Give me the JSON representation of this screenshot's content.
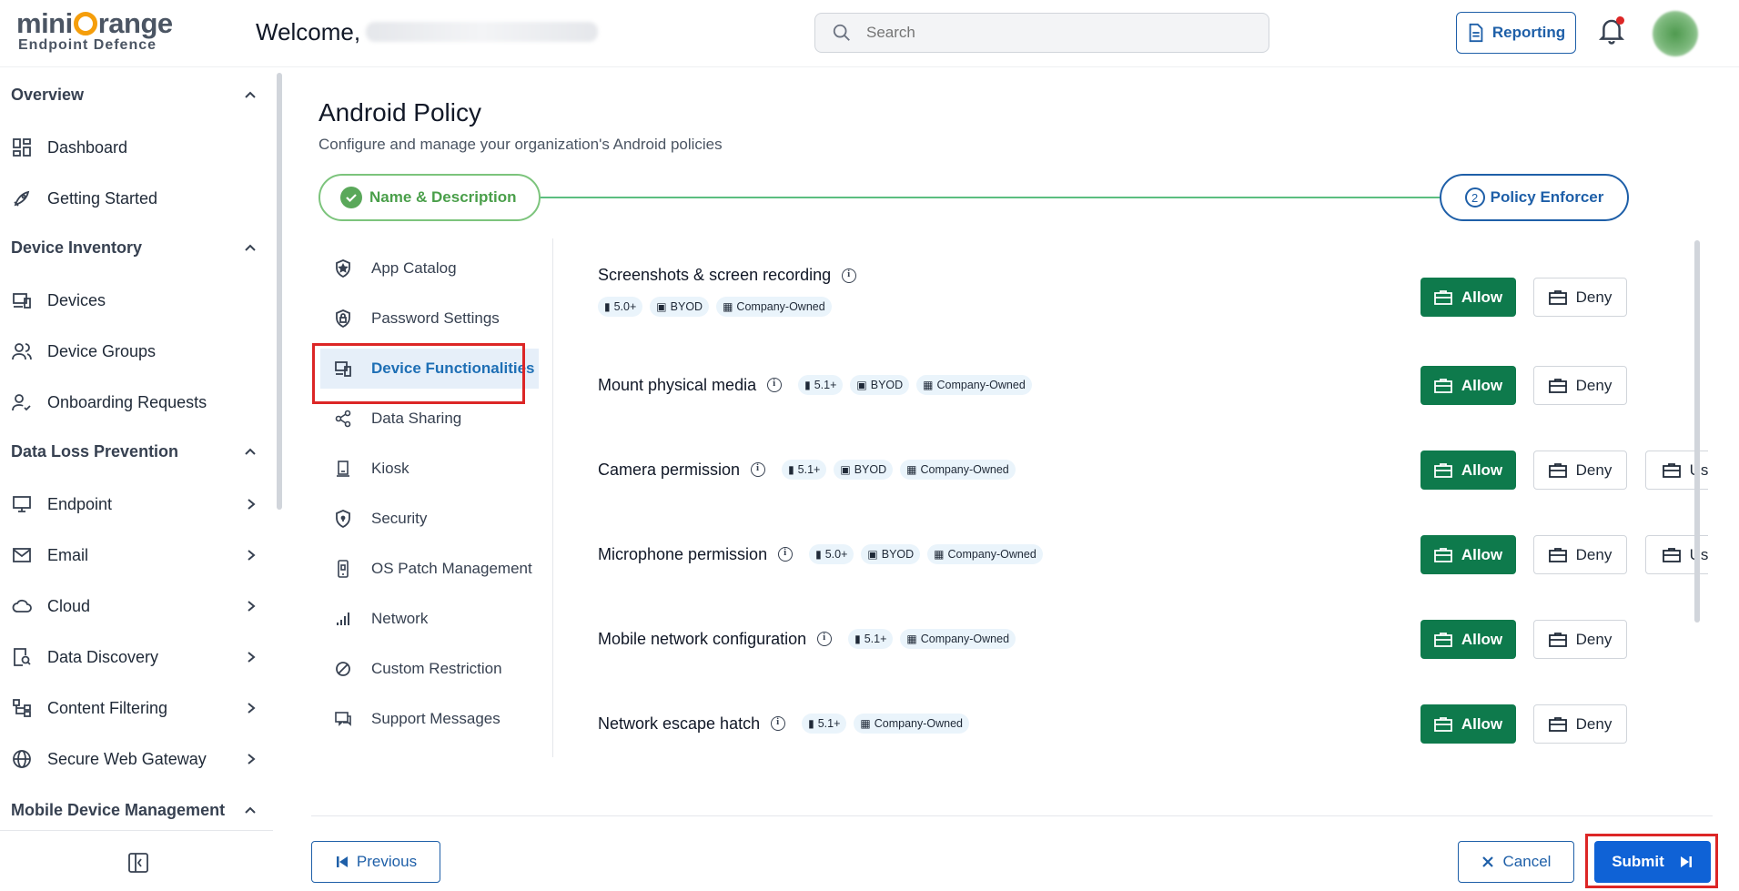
{
  "header": {
    "logo_main": "mini",
    "logo_main_suffix": "range",
    "logo_sub": "Endpoint Defence",
    "welcome": "Welcome,",
    "search_placeholder": "Search",
    "reporting_label": "Reporting",
    "notification_dot_color": "#dc2626"
  },
  "sidebar": {
    "sections": [
      {
        "label": "Overview"
      },
      {
        "label": "Device Inventory"
      },
      {
        "label": "Data Loss Prevention"
      },
      {
        "label": "Mobile Device Management"
      }
    ],
    "items": [
      {
        "label": "Dashboard",
        "icon": "dashboard-icon"
      },
      {
        "label": "Getting Started",
        "icon": "rocket-icon"
      },
      {
        "label": "Devices",
        "icon": "devices-icon"
      },
      {
        "label": "Device Groups",
        "icon": "users-icon"
      },
      {
        "label": "Onboarding Requests",
        "icon": "user-check-icon"
      },
      {
        "label": "Endpoint",
        "icon": "monitor-icon"
      },
      {
        "label": "Email",
        "icon": "mail-icon"
      },
      {
        "label": "Cloud",
        "icon": "cloud-icon"
      },
      {
        "label": "Data Discovery",
        "icon": "file-search-icon"
      },
      {
        "label": "Content Filtering",
        "icon": "filter-tree-icon"
      },
      {
        "label": "Secure Web Gateway",
        "icon": "globe-icon"
      }
    ]
  },
  "page": {
    "title": "Android Policy",
    "subtitle": "Configure and manage your organization's Android policies",
    "step1_label": "Name & Description",
    "step2_number": "2",
    "step2_label": "Policy Enforcer"
  },
  "submenu": [
    {
      "label": "App Catalog",
      "icon": "shield-star-icon"
    },
    {
      "label": "Password Settings",
      "icon": "shield-lock-icon"
    },
    {
      "label": "Device Functionalities",
      "icon": "devices-icon",
      "active": true
    },
    {
      "label": "Data Sharing",
      "icon": "share-icon"
    },
    {
      "label": "Kiosk",
      "icon": "kiosk-icon"
    },
    {
      "label": "Security",
      "icon": "shield-icon"
    },
    {
      "label": "OS Patch Management",
      "icon": "phone-patch-icon"
    },
    {
      "label": "Network",
      "icon": "signal-icon"
    },
    {
      "label": "Custom Restriction",
      "icon": "ban-icon"
    },
    {
      "label": "Support Messages",
      "icon": "message-icon"
    }
  ],
  "settings": [
    {
      "title": "Screenshots & screen recording",
      "version": "5.0+",
      "byod": "BYOD",
      "company": "Company-Owned",
      "allow": "Allow",
      "deny": "Deny"
    },
    {
      "title": "Mount physical media",
      "version": "5.1+",
      "byod": "BYOD",
      "company": "Company-Owned",
      "allow": "Allow",
      "deny": "Deny"
    },
    {
      "title": "Camera permission",
      "version": "5.1+",
      "byod": "BYOD",
      "company": "Company-Owned",
      "allow": "Allow",
      "deny": "Deny",
      "choice": "User choice"
    },
    {
      "title": "Microphone permission",
      "version": "5.0+",
      "byod": "BYOD",
      "company": "Company-Owned",
      "allow": "Allow",
      "deny": "Deny",
      "choice": "User choice"
    },
    {
      "title": "Mobile network configuration",
      "version": "5.1+",
      "company": "Company-Owned",
      "allow": "Allow",
      "deny": "Deny"
    },
    {
      "title": "Network escape hatch",
      "version": "5.1+",
      "company": "Company-Owned",
      "allow": "Allow",
      "deny": "Deny"
    }
  ],
  "footer": {
    "previous": "Previous",
    "cancel": "Cancel",
    "submit": "Submit"
  },
  "colors": {
    "accent_blue": "#1e5fa8",
    "allow_green": "#0e7a4c",
    "submit_blue": "#0f62d6",
    "highlight_red": "#dc2626"
  }
}
